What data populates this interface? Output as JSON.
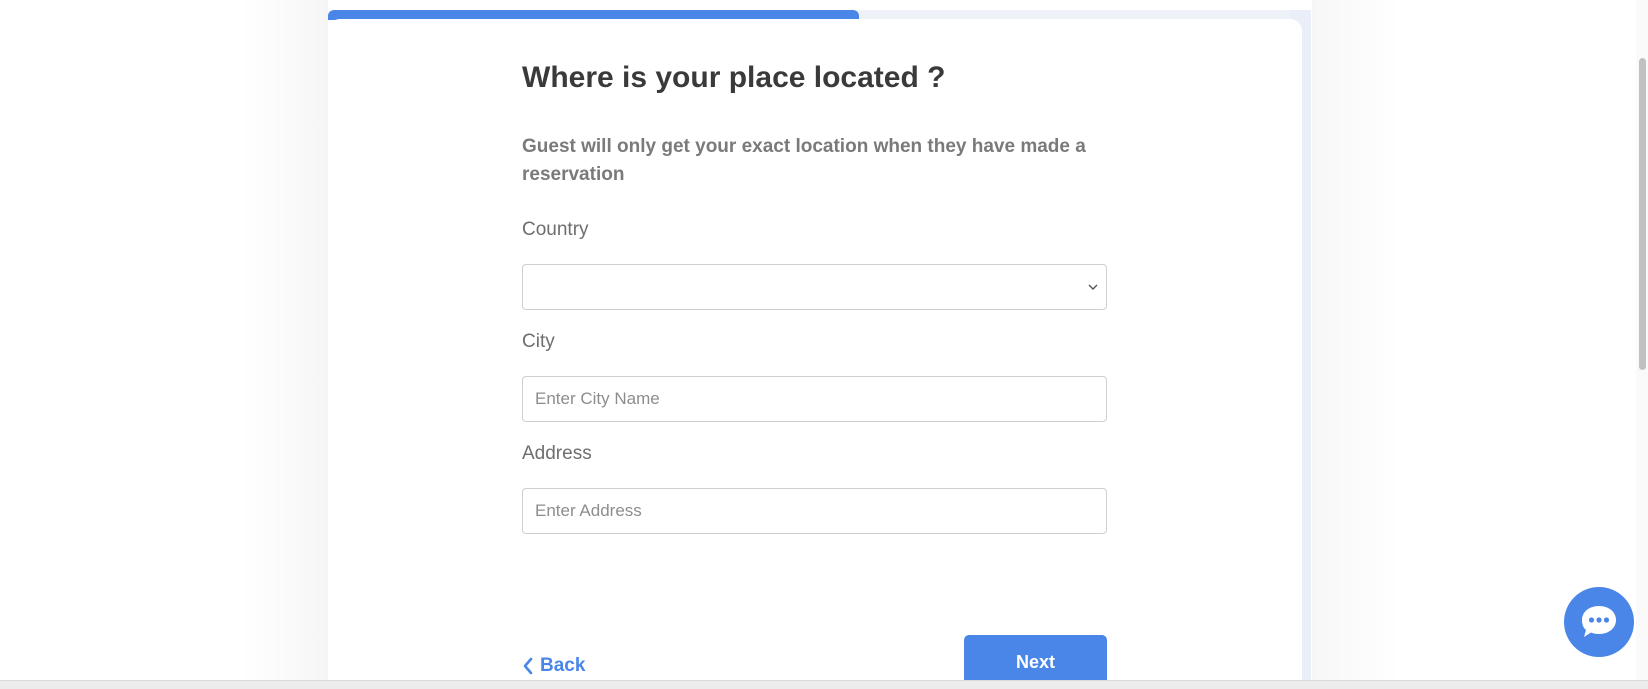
{
  "progress": {
    "value_percent": 54,
    "color": "#4a86e8"
  },
  "form": {
    "title": "Where is your place located ?",
    "subtitle": "Guest will only get your exact location when they have made a reservation",
    "country": {
      "label": "Country",
      "value": ""
    },
    "city": {
      "label": "City",
      "value": "",
      "placeholder": "Enter City Name"
    },
    "address": {
      "label": "Address",
      "value": "",
      "placeholder": "Enter Address"
    }
  },
  "nav": {
    "back_label": "Back",
    "next_label": "Next"
  },
  "icons": {
    "back": "chevron-left-icon",
    "select": "chevron-down-icon",
    "chat": "chat-bubble-icon"
  },
  "colors": {
    "accent": "#4a86e8",
    "title": "#3a3a3a",
    "subtitle": "#7a7a7a"
  }
}
